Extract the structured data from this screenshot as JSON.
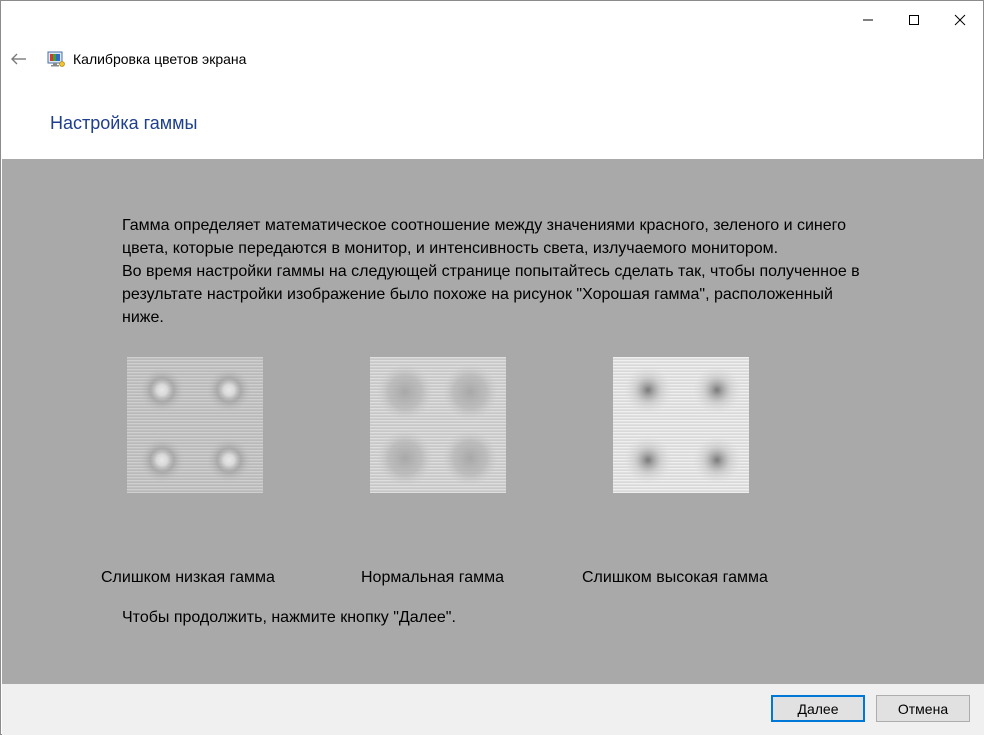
{
  "window": {
    "title": "Калибровка цветов экрана",
    "controls": {
      "minimize": "minimize-icon",
      "maximize": "maximize-icon",
      "close": "close-icon"
    }
  },
  "page": {
    "heading": "Настройка гаммы",
    "description": [
      "Гамма определяет математическое соотношение между значениями красного, зеленого и синего цвета, которые передаются в монитор, и интенсивность света, излучаемого монитором.",
      "Во время настройки гаммы на следующей странице попытайтесь сделать так, чтобы полученное в результате настройки изображение было похоже на рисунок \"Хорошая гамма\", расположенный ниже."
    ],
    "samples": [
      {
        "label": "Слишком низкая гамма"
      },
      {
        "label": "Нормальная гамма"
      },
      {
        "label": "Слишком высокая гамма"
      }
    ],
    "continue_note": "Чтобы продолжить, нажмите кнопку \"Далее\"."
  },
  "footer": {
    "next_label": "Далее",
    "cancel_label": "Отмена"
  },
  "colors": {
    "heading": "#1e3e8e",
    "content_bg": "#a9a9a9",
    "footer_bg": "#f0f0f0",
    "primary_border": "#0078d7"
  }
}
